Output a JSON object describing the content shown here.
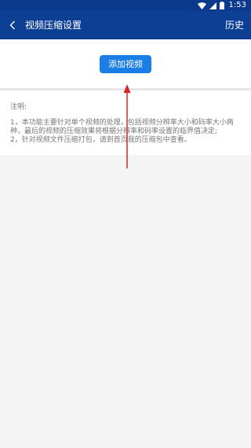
{
  "status_bar": {
    "time": "1:53",
    "icons": [
      "wifi-icon",
      "signal-icon",
      "battery-icon"
    ]
  },
  "app_bar": {
    "back_icon": "chevron-left-icon",
    "title": "视频压缩设置",
    "history_label": "历史"
  },
  "main": {
    "add_video_label": "添加视频"
  },
  "notes": {
    "heading": "注明:",
    "line1": "1，本功能主要针对单个视频的处理，包括视频分辨率大小和码率大小两种，最后的视频的压缩效果将根据分辨率和码率设置的临界值决定;",
    "line2": "2，针对视频文件压缩打包，请到首页我的压缩包中查看。"
  },
  "colors": {
    "header": "#0d3f94",
    "accent": "#1a7ee6",
    "annotation_arrow": "#d9262a"
  }
}
